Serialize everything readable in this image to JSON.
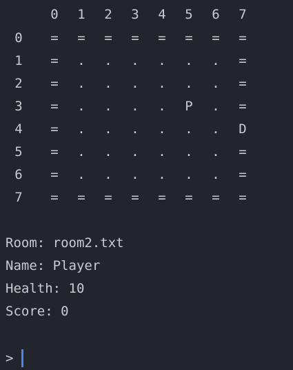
{
  "map": {
    "col_headers": [
      "0",
      "1",
      "2",
      "3",
      "4",
      "5",
      "6",
      "7"
    ],
    "rows": [
      {
        "label": "0",
        "cells": [
          "=",
          "=",
          "=",
          "=",
          "=",
          "=",
          "=",
          "="
        ]
      },
      {
        "label": "1",
        "cells": [
          "=",
          ".",
          ".",
          ".",
          ".",
          ".",
          ".",
          "="
        ]
      },
      {
        "label": "2",
        "cells": [
          "=",
          ".",
          ".",
          ".",
          ".",
          ".",
          ".",
          "="
        ]
      },
      {
        "label": "3",
        "cells": [
          "=",
          ".",
          ".",
          ".",
          ".",
          "P",
          ".",
          "="
        ]
      },
      {
        "label": "4",
        "cells": [
          "=",
          ".",
          ".",
          ".",
          ".",
          ".",
          ".",
          "D"
        ]
      },
      {
        "label": "5",
        "cells": [
          "=",
          ".",
          ".",
          ".",
          ".",
          ".",
          ".",
          "="
        ]
      },
      {
        "label": "6",
        "cells": [
          "=",
          ".",
          ".",
          ".",
          ".",
          ".",
          ".",
          "="
        ]
      },
      {
        "label": "7",
        "cells": [
          "=",
          "=",
          "=",
          "=",
          "=",
          "=",
          "=",
          "="
        ]
      }
    ]
  },
  "status": {
    "room": "Room: room2.txt",
    "name": "Name: Player",
    "health": "Health: 10",
    "score": "Score: 0"
  },
  "prompt": {
    "symbol": ">"
  }
}
